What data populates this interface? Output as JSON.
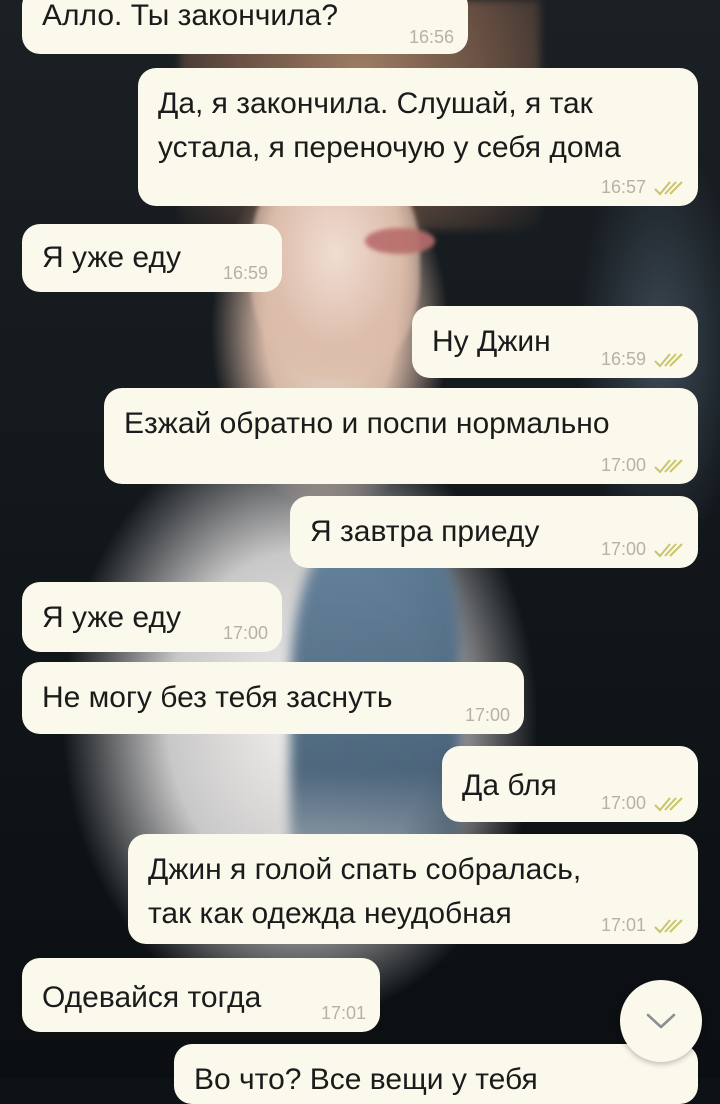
{
  "messages": [
    {
      "dir": "in",
      "text": "Алло. Ты закончила?",
      "time": "16:56"
    },
    {
      "dir": "out",
      "text": "Да, я закончила. Слушай, я так\nустала, я переночую у себя дома",
      "time": "16:57"
    },
    {
      "dir": "in",
      "text": "Я уже еду",
      "time": "16:59"
    },
    {
      "dir": "out",
      "text": "Ну Джин",
      "time": "16:59"
    },
    {
      "dir": "out",
      "text": "Езжай обратно и поспи нормально",
      "time": "17:00"
    },
    {
      "dir": "out",
      "text": "Я завтра приеду",
      "time": "17:00"
    },
    {
      "dir": "in",
      "text": "Я уже еду",
      "time": "17:00"
    },
    {
      "dir": "in",
      "text": "Не могу без тебя заснуть",
      "time": "17:00"
    },
    {
      "dir": "out",
      "text": "Да бля",
      "time": "17:00"
    },
    {
      "dir": "out",
      "text": "Джин я голой спать собралась,\nтак как одежда неудобная",
      "time": "17:01"
    },
    {
      "dir": "in",
      "text": "Одевайся тогда",
      "time": "17:01"
    },
    {
      "dir": "out",
      "text": "Во что? Все вещи у тебя",
      "time": ""
    }
  ],
  "colors": {
    "bubble": "#fbf8ec",
    "text": "#1b1b1b",
    "time": "#b7b3a4",
    "ticks": "#c9c66a"
  },
  "icons": {
    "read_receipt": "double-check-icon",
    "scroll_down": "chevron-down-icon"
  }
}
